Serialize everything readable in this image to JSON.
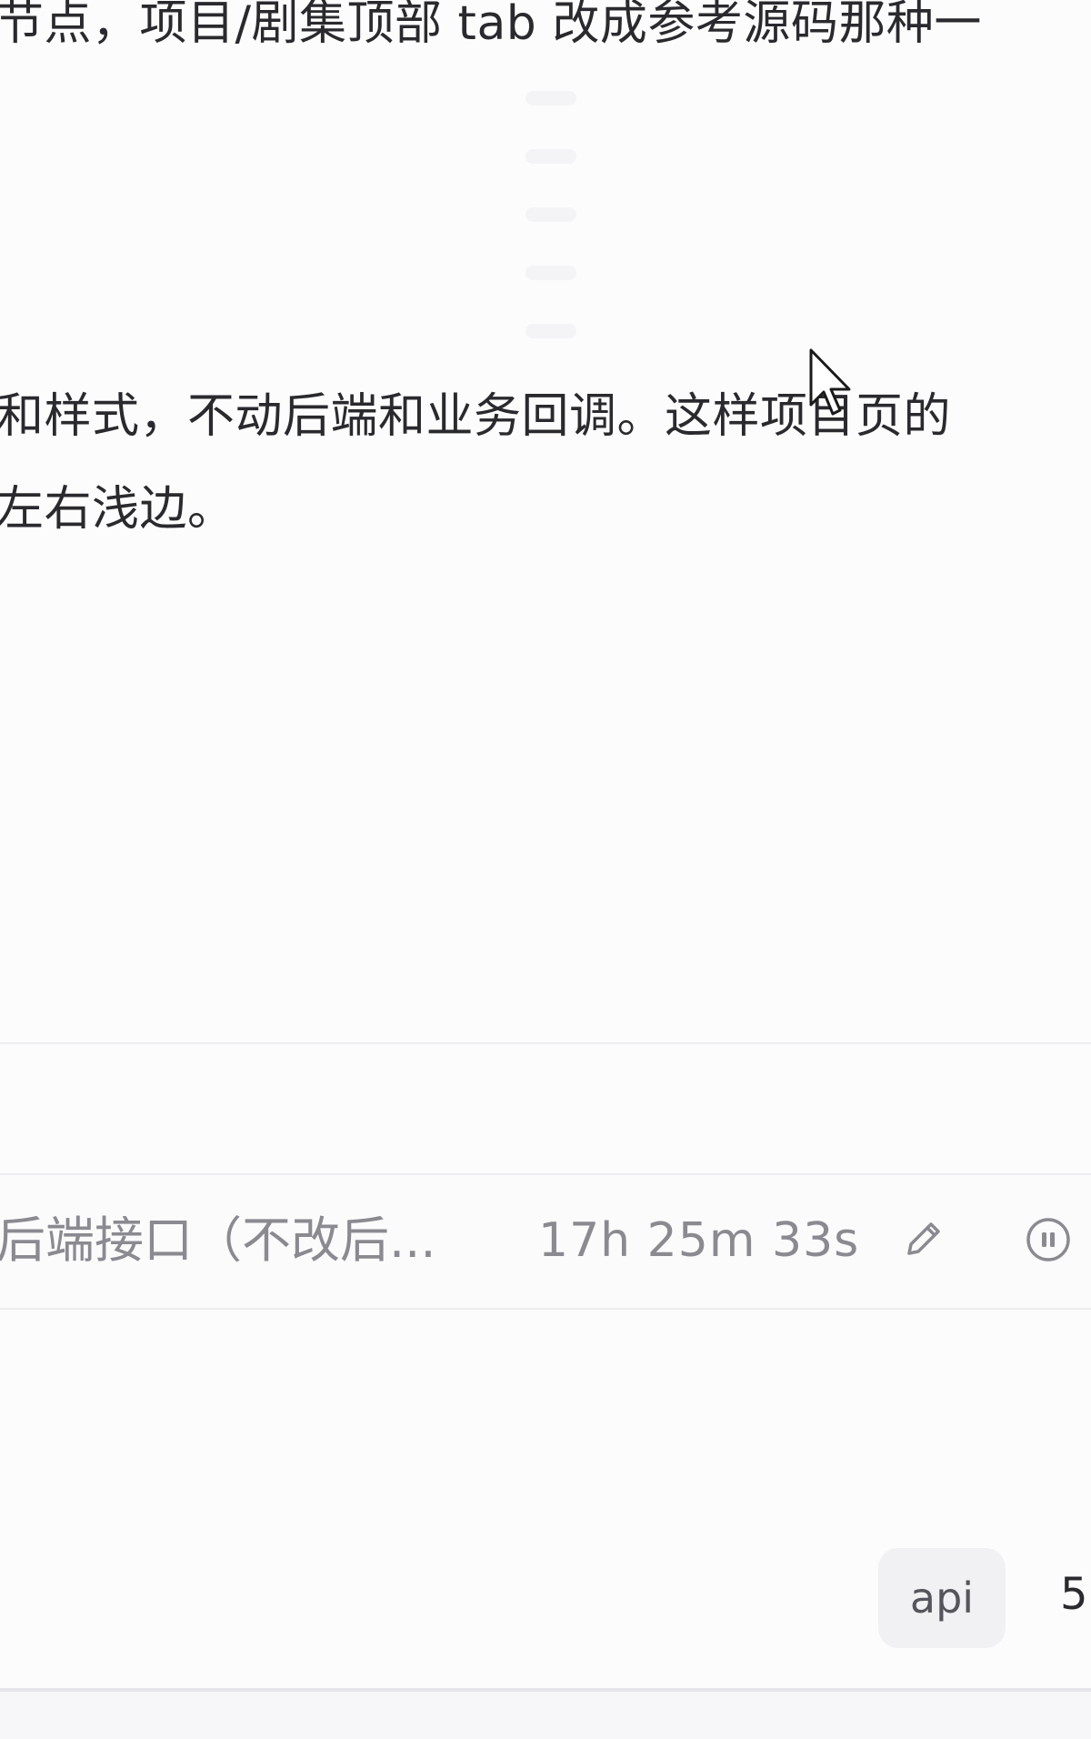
{
  "message": {
    "line_top": "节点，项目/剧集顶部 tab 改成参考源码那种一",
    "line_2": "和样式，不动后端和业务回调。这样项目页的",
    "line_3": "左右浅边。"
  },
  "task": {
    "title": "后端接口（不改后...",
    "elapsed": "17h 25m 33s",
    "edit_icon": "pencil-icon",
    "stop_icon": "stop-circle-icon"
  },
  "composer": {
    "chip_label": "api",
    "model_label": "5."
  },
  "colors": {
    "background": "#fcfcfd",
    "text": "#2a2a2e",
    "muted": "#8a8a90",
    "divider": "#ececef",
    "chip_bg": "#f1f1f3"
  }
}
